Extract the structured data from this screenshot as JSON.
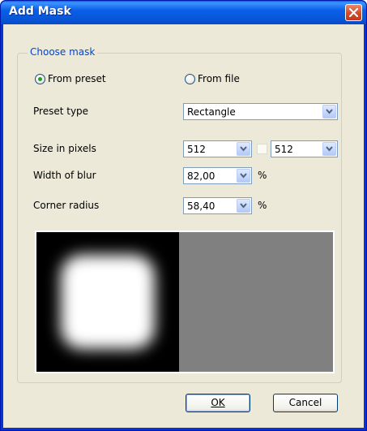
{
  "window": {
    "title": "Add Mask"
  },
  "group": {
    "legend": "Choose mask"
  },
  "source": {
    "from_preset": "From preset",
    "from_file": "From file",
    "selected": "from_preset"
  },
  "preset_type": {
    "label": "Preset type",
    "value": "Rectangle"
  },
  "size": {
    "label": "Size in pixels",
    "width": "512",
    "height": "512",
    "linked": false
  },
  "blur": {
    "label": "Width of blur",
    "value": "82,00",
    "unit": "%"
  },
  "corner": {
    "label": "Corner radius",
    "value": "58,40",
    "unit": "%"
  },
  "buttons": {
    "ok": "OK",
    "cancel": "Cancel"
  },
  "colors": {
    "title_bar": "#0757d8",
    "dialog_bg": "#ece9d8",
    "legend_text": "#0046d5",
    "preview_mask": "#000000",
    "preview_gray": "#808080"
  }
}
